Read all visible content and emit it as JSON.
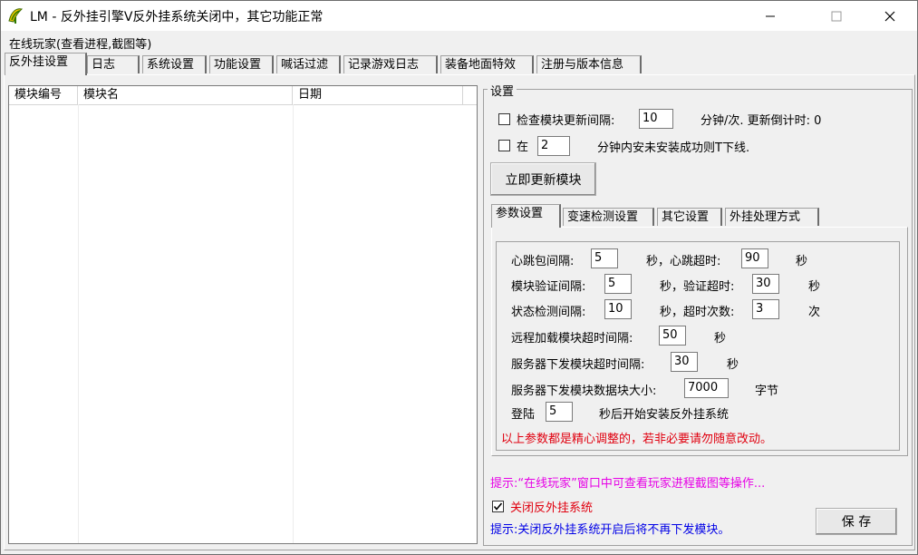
{
  "window": {
    "title": "LM - 反外挂引擎Ⅴ反外挂系统关闭中，其它功能正常",
    "minimize_label": "—",
    "maximize_label": "☐",
    "close_label": "✕"
  },
  "menu": {
    "item": "在线玩家(查看进程,截图等)"
  },
  "main_tabs": [
    {
      "label": "反外挂设置",
      "active": true
    },
    {
      "label": "日志"
    },
    {
      "label": "系统设置"
    },
    {
      "label": "功能设置"
    },
    {
      "label": "喊话过滤"
    },
    {
      "label": "记录游戏日志"
    },
    {
      "label": "装备地面特效"
    },
    {
      "label": "注册与版本信息"
    }
  ],
  "module_list": {
    "columns": [
      "模块编号",
      "模块名",
      "日期"
    ]
  },
  "settings": {
    "group_title": "设置",
    "check_update": {
      "label": "检查模块更新间隔:",
      "value": "10",
      "suffix": "分钟/次. 更新倒计时: 0"
    },
    "kick": {
      "label": "在",
      "value": "2",
      "suffix": "分钟内安未安装成功则T下线."
    },
    "update_now_button": "立即更新模块",
    "sub_tabs": [
      {
        "label": "参数设置",
        "active": true
      },
      {
        "label": "变速检测设置"
      },
      {
        "label": "其它设置"
      },
      {
        "label": "外挂处理方式"
      }
    ],
    "params": {
      "heartbeat_interval_label": "心跳包间隔:",
      "heartbeat_interval": "5",
      "heartbeat_timeout_label": "秒，心跳超时:",
      "heartbeat_timeout": "90",
      "sec1": "秒",
      "verify_interval_label": "模块验证间隔:",
      "verify_interval": "5",
      "verify_timeout_label": "秒，验证超时:",
      "verify_timeout": "30",
      "sec2": "秒",
      "status_interval_label": "状态检测间隔:",
      "status_interval": "10",
      "timeout_count_label": "秒，超时次数:",
      "timeout_count": "3",
      "times": "次",
      "remote_timeout_label": "远程加载模块超时间隔:",
      "remote_timeout": "50",
      "sec3": "秒",
      "server_send_timeout_label": "服务器下发模块超时间隔:",
      "server_send_timeout": "30",
      "sec4": "秒",
      "block_size_label": "服务器下发模块数据块大小:",
      "block_size": "7000",
      "bytes": "字节",
      "login_label": "登陆",
      "login_delay": "5",
      "login_suffix": "秒后开始安装反外挂系统",
      "warning": "以上参数都是精心调整的，若非必要请勿随意改动。"
    },
    "hint_online": "提示:“在线玩家”窗口中可查看玩家进程截图等操作...",
    "close_system_label": "关闭反外挂系统",
    "close_system_checked": true,
    "hint_close": "提示:关闭反外挂系统开启后将不再下发模块。",
    "save_button": "保 存"
  },
  "colors": {
    "warning": "#e0000f",
    "hint_magenta": "#e600e6",
    "hint_blue": "#0000e6"
  }
}
